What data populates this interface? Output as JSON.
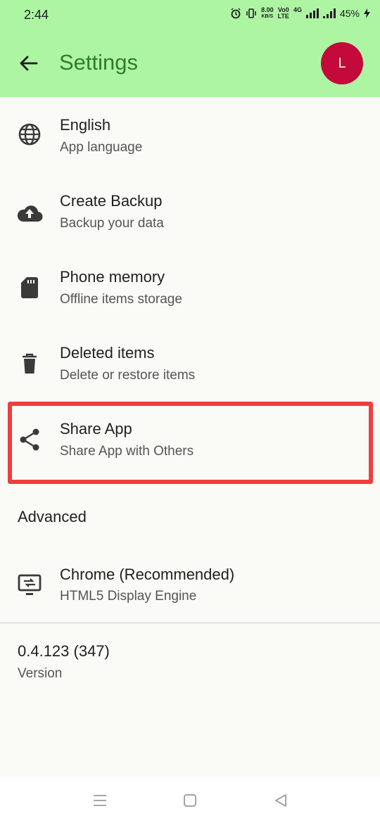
{
  "status": {
    "time": "2:44",
    "net_speed": "8.00",
    "net_unit": "KB/S",
    "volte_top": "Vo0",
    "volte_bottom": "LTE",
    "network": "4G",
    "battery": "45%"
  },
  "header": {
    "title": "Settings",
    "avatar_letter": "L",
    "background": "#adf5a3",
    "title_color": "#2f7d26",
    "avatar_color": "#c4093b"
  },
  "items": [
    {
      "title": "English",
      "subtitle": "App language",
      "icon": "globe-icon"
    },
    {
      "title": "Create Backup",
      "subtitle": "Backup your data",
      "icon": "cloud-upload-icon"
    },
    {
      "title": "Phone memory",
      "subtitle": "Offline items storage",
      "icon": "sd-card-icon"
    },
    {
      "title": "Deleted items",
      "subtitle": "Delete or restore items",
      "icon": "trash-icon"
    },
    {
      "title": "Share App",
      "subtitle": "Share App with Others",
      "icon": "share-icon"
    }
  ],
  "advanced": {
    "header": "Advanced",
    "engine": {
      "title": "Chrome (Recommended)",
      "subtitle": "HTML5 Display Engine",
      "icon": "display-engine-icon"
    }
  },
  "version": {
    "value": "0.4.123 (347)",
    "label": "Version"
  },
  "highlight_color": "#ee3e3e",
  "nav": {
    "icons": [
      "menu-icon",
      "home-icon",
      "back-triangle-icon"
    ]
  }
}
